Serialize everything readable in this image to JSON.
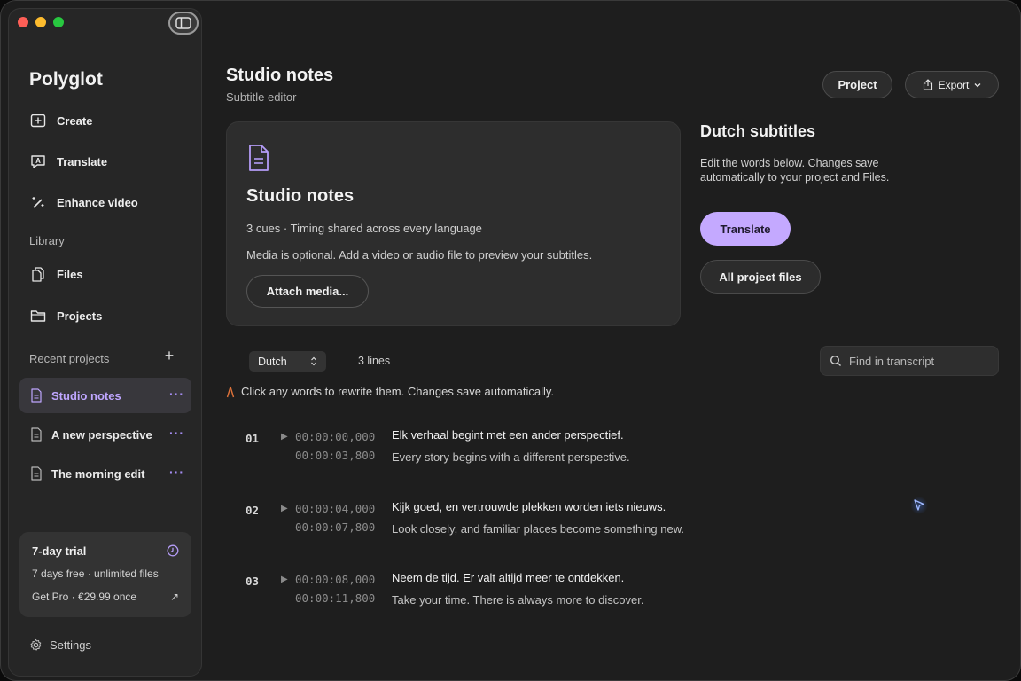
{
  "sidebar": {
    "app_name": "Polyglot",
    "nav": [
      {
        "label": "Create",
        "icon": "plus-square-icon"
      },
      {
        "label": "Translate",
        "icon": "translate-icon"
      },
      {
        "label": "Enhance video",
        "icon": "magic-wand-icon"
      }
    ],
    "library_label": "Library",
    "library": [
      {
        "label": "Files",
        "icon": "files-icon"
      },
      {
        "label": "Projects",
        "icon": "folder-icon"
      }
    ],
    "recent_label": "Recent projects",
    "recent": [
      {
        "label": "Studio notes",
        "active": true
      },
      {
        "label": "A new perspective",
        "active": false
      },
      {
        "label": "The morning edit",
        "active": false
      }
    ],
    "more_glyph": "···",
    "trial": {
      "title": "7-day trial",
      "subtitle": "7 days free · unlimited files",
      "cta": "Get Pro · €29.99 once",
      "cta_arrow": "↗"
    },
    "settings_label": "Settings"
  },
  "header": {
    "title": "Studio notes",
    "subtitle": "Subtitle editor",
    "project_button": "Project",
    "export_button": "Export"
  },
  "card": {
    "title": "Studio notes",
    "meta": "3 cues · Timing shared across every language",
    "media_note": "Media is optional. Add a video or audio file to preview your subtitles.",
    "attach_button": "Attach media..."
  },
  "side_panel": {
    "title": "Dutch subtitles",
    "description": "Edit the words below. Changes save automatically to your project and Files.",
    "translate_button": "Translate",
    "all_files_button": "All project files"
  },
  "toolbar": {
    "language": "Dutch",
    "lines_count": "3 lines",
    "search_placeholder": "Find in transcript"
  },
  "hint": "Click any words to rewrite them. Changes save automatically.",
  "cues": [
    {
      "num": "01",
      "start": "00:00:00,000",
      "end": "00:00:03,800",
      "text": "Elk verhaal begint met een ander perspectief.",
      "translation": "Every story begins with a different perspective."
    },
    {
      "num": "02",
      "start": "00:00:04,000",
      "end": "00:00:07,800",
      "text": "Kijk goed, en vertrouwde plekken worden iets nieuws.",
      "translation": "Look closely, and familiar places become something new."
    },
    {
      "num": "03",
      "start": "00:00:08,000",
      "end": "00:00:11,800",
      "text": "Neem de tijd. Er valt altijd meer te ontdekken.",
      "translation": "Take your time. There is always more to discover."
    }
  ],
  "colors": {
    "accent": "#c4a9ff",
    "accent_text": "#bfa6ff",
    "background": "#1e1e1e",
    "sidebar": "#262626"
  }
}
